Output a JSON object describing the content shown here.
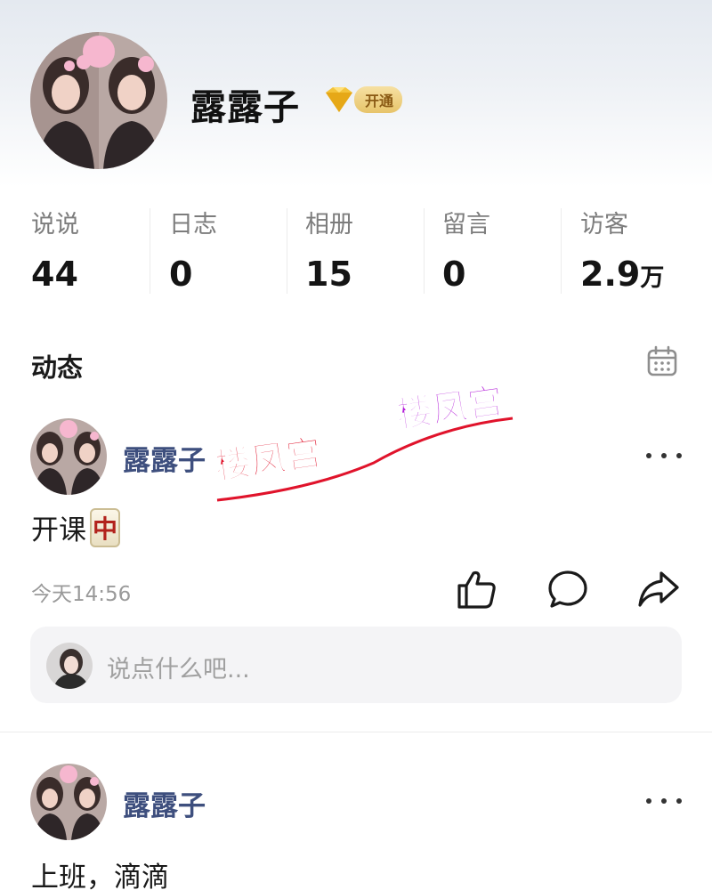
{
  "profile": {
    "name": "露露子",
    "vip_label": "开通"
  },
  "stats": [
    {
      "label": "说说",
      "value": "44",
      "unit": ""
    },
    {
      "label": "日志",
      "value": "0",
      "unit": ""
    },
    {
      "label": "相册",
      "value": "15",
      "unit": ""
    },
    {
      "label": "留言",
      "value": "0",
      "unit": ""
    },
    {
      "label": "访客",
      "value": "2.9",
      "unit": "万"
    }
  ],
  "feed": {
    "title": "动态"
  },
  "posts": [
    {
      "author": "露露子",
      "content": "开课",
      "tile": "中",
      "time": "今天14:56"
    },
    {
      "author": "露露子",
      "content": "上班，滴滴"
    }
  ],
  "comment": {
    "placeholder": "说点什么吧..."
  },
  "watermark": {
    "text1": "楼凤宫",
    "text2": "楼凤宫"
  },
  "colors": {
    "author": "#3e4f7e",
    "watermark_red": "#e0132b",
    "watermark_magenta": "#b21ad8"
  },
  "icons": {
    "calendar": "calendar-icon",
    "more": "more-icon",
    "like": "thumbs-up-icon",
    "comment": "comment-bubble-icon",
    "share": "share-arrow-icon"
  }
}
